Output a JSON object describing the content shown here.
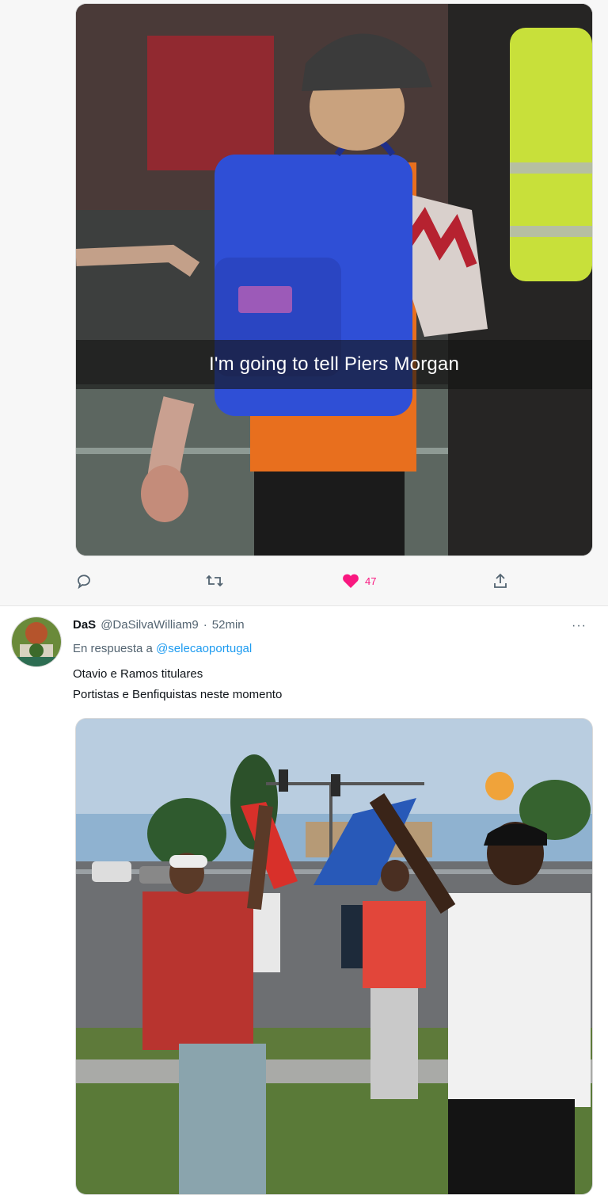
{
  "tweet1": {
    "caption": "I'm going to tell Piers Morgan",
    "actions": {
      "reply_icon": "reply-icon",
      "retweet_icon": "retweet-icon",
      "like_icon": "heart-filled-icon",
      "like_count": "47",
      "share_icon": "share-icon"
    }
  },
  "tweet2": {
    "author_name": "DaS",
    "author_handle": "@DaSilvaWilliam9",
    "separator": "·",
    "time": "52min",
    "more": "···",
    "reply_prefix": "En respuesta a",
    "reply_to": "@selecaoportugal",
    "text_lines": [
      "Otavio e Ramos titulares",
      "Portistas e Benfiquistas neste momento"
    ]
  },
  "colors": {
    "like": "#f91880",
    "link": "#1d9bf0",
    "muted": "#536471"
  }
}
